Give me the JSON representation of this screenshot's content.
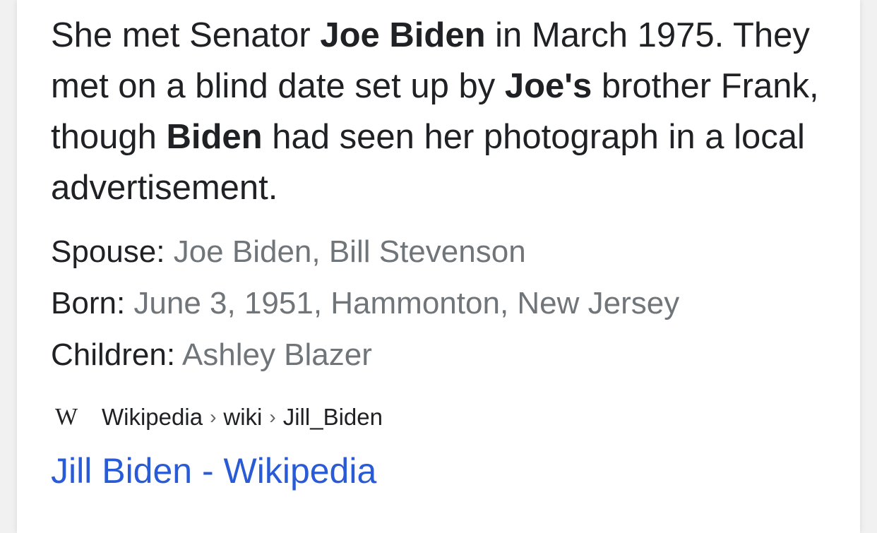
{
  "snippet": {
    "t1": "She met Senator ",
    "b1": "Joe Biden",
    "t2": " in March 1975. They met on a blind date set up by ",
    "b2": "Joe's",
    "t3": " brother Frank, though ",
    "b3": "Biden",
    "t4": " had seen her photograph in a local advertisement."
  },
  "facts": [
    {
      "label": "Spouse: ",
      "value": "Joe Biden, Bill Stevenson"
    },
    {
      "label": "Born: ",
      "value": "June 3, 1951, Hammonton, New Jersey"
    },
    {
      "label": "Children: ",
      "value": "Ashley Blazer"
    }
  ],
  "source": {
    "logo_icon": "wikipedia-w-icon",
    "logo_text": "W",
    "breadcrumb": [
      "Wikipedia",
      "wiki",
      "Jill_Biden"
    ],
    "separator": "›"
  },
  "result": {
    "title": "Jill Biden - Wikipedia"
  },
  "colors": {
    "text": "#202124",
    "muted": "#70757a",
    "link": "#2a5bd7"
  }
}
